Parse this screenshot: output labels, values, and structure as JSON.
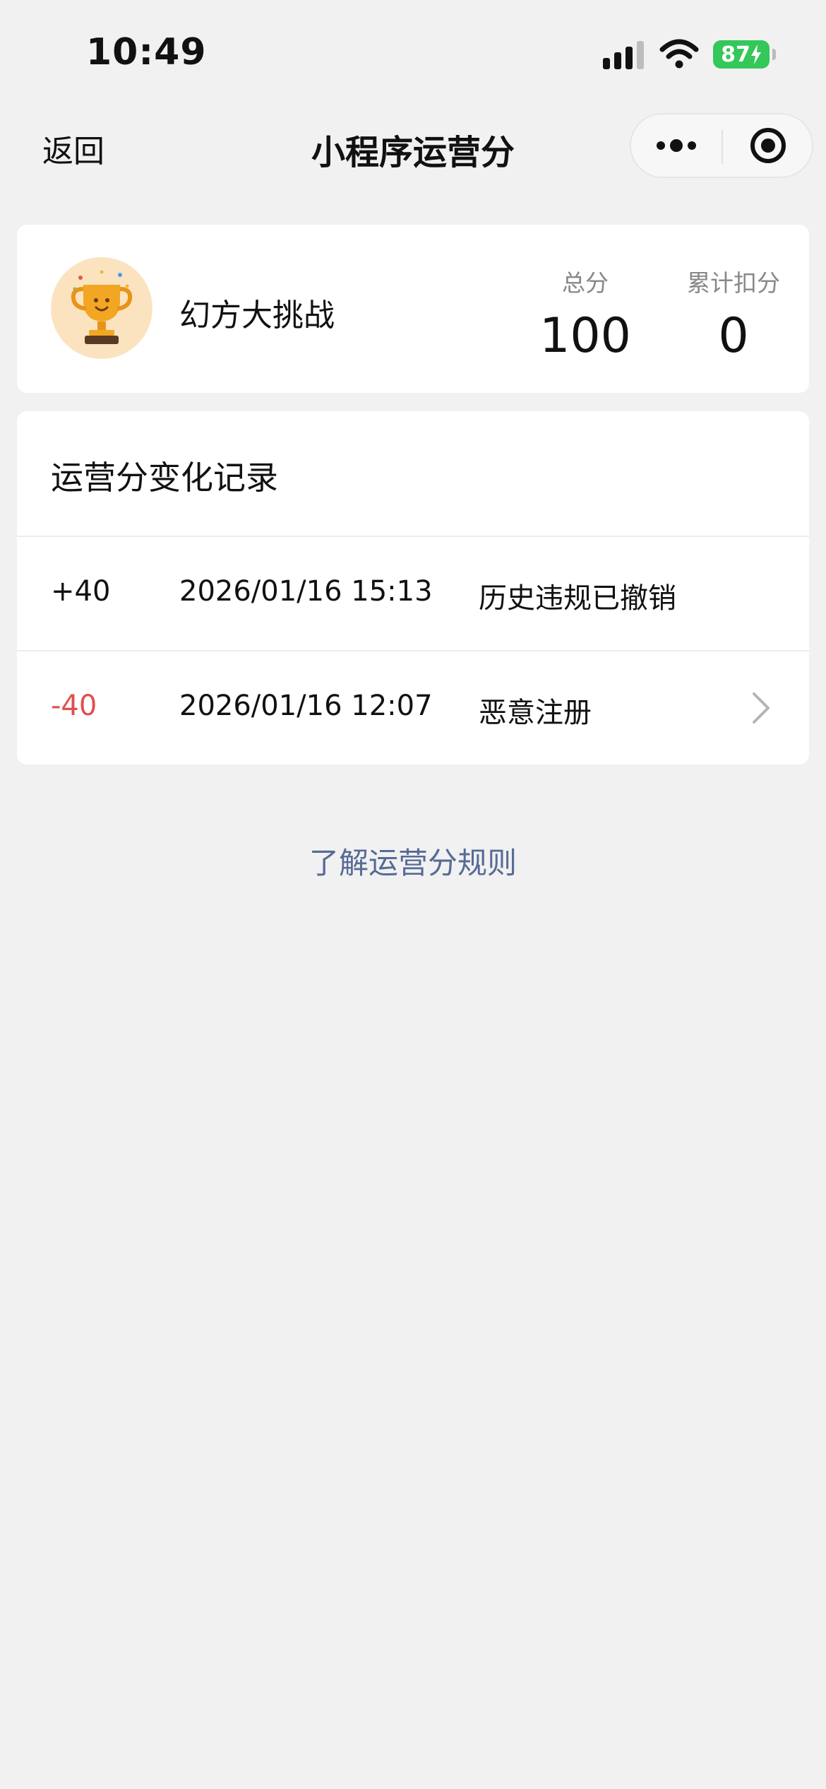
{
  "status_bar": {
    "time": "10:49",
    "battery_level": "87",
    "battery_charging": true,
    "battery_color": "#34c759"
  },
  "nav": {
    "back_label": "返回",
    "title": "小程序运营分"
  },
  "summary": {
    "app_name": "幻方大挑战",
    "avatar_icon": "trophy-icon",
    "total_label": "总分",
    "total_value": "100",
    "deduct_label": "累计扣分",
    "deduct_value": "0"
  },
  "records": {
    "title": "运营分变化记录",
    "rows": [
      {
        "delta": "+40",
        "time": "2026/01/16 15:13",
        "reason": "历史违规已撤销",
        "clickable": false
      },
      {
        "delta": "-40",
        "time": "2026/01/16 12:07",
        "reason": "恶意注册",
        "clickable": true
      }
    ]
  },
  "footer": {
    "rules_link": "了解运营分规则",
    "link_color": "#576b95",
    "negative_color": "#e04f4f"
  }
}
